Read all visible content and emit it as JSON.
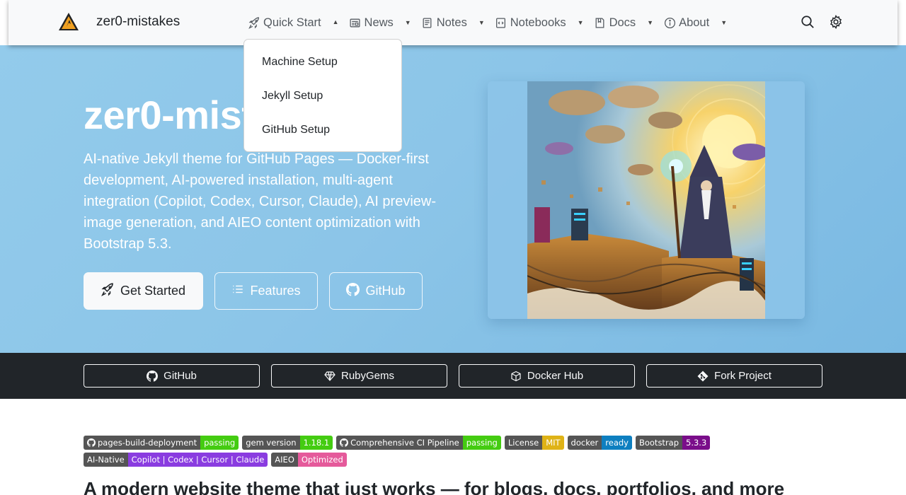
{
  "navbar": {
    "brand": "zer0-mistakes",
    "items": [
      {
        "label": "Quick Start",
        "icon": "rocket-icon",
        "open": true
      },
      {
        "label": "News",
        "icon": "newspaper-icon",
        "open": false
      },
      {
        "label": "Notes",
        "icon": "notes-icon",
        "open": false
      },
      {
        "label": "Notebooks",
        "icon": "notebook-icon",
        "open": false
      },
      {
        "label": "Docs",
        "icon": "docs-icon",
        "open": false
      },
      {
        "label": "About",
        "icon": "info-icon",
        "open": false
      }
    ],
    "tools": [
      "search-icon",
      "gear-icon"
    ]
  },
  "dropdown": {
    "items": [
      "Machine Setup",
      "Jekyll Setup",
      "GitHub Setup"
    ]
  },
  "hero": {
    "title": "zer0-mistakes",
    "lead": "AI-native Jekyll theme for GitHub Pages — Docker-first development, AI-powered installation, multi-agent integration (Copilot, Codex, Cursor, Claude), AI preview-image generation, and AIEO content optimization with Bootstrap 5.3.",
    "buttons": {
      "get_started": "Get Started",
      "features": "Features",
      "github": "GitHub"
    }
  },
  "strip": {
    "buttons": [
      "GitHub",
      "RubyGems",
      "Docker Hub",
      "Fork Project"
    ]
  },
  "badges": {
    "row1": [
      {
        "label": "pages-build-deployment",
        "value": "passing",
        "color": "#4c1",
        "gh": true
      },
      {
        "label": "gem version",
        "value": "1.18.1",
        "color": "#4c1",
        "gh": false
      },
      {
        "label": "Comprehensive CI Pipeline",
        "value": "passing",
        "color": "#4c1",
        "gh": true
      },
      {
        "label": "License",
        "value": "MIT",
        "color": "#dfb317",
        "gh": false
      },
      {
        "label": "docker",
        "value": "ready",
        "color": "#0e7fc0",
        "gh": false
      },
      {
        "label": "Bootstrap",
        "value": "5.3.3",
        "color": "#7a0d8a",
        "gh": false
      }
    ],
    "row2": [
      {
        "label": "AI-Native",
        "value": "Copilot | Codex | Cursor | Claude",
        "color": "#8a3ce0",
        "gh": false
      },
      {
        "label": "AIEO",
        "value": "Optimized",
        "color": "#e55a9b",
        "gh": false
      }
    ]
  },
  "tagline": "A modern website theme that just works — for blogs, docs, portfolios, and more"
}
